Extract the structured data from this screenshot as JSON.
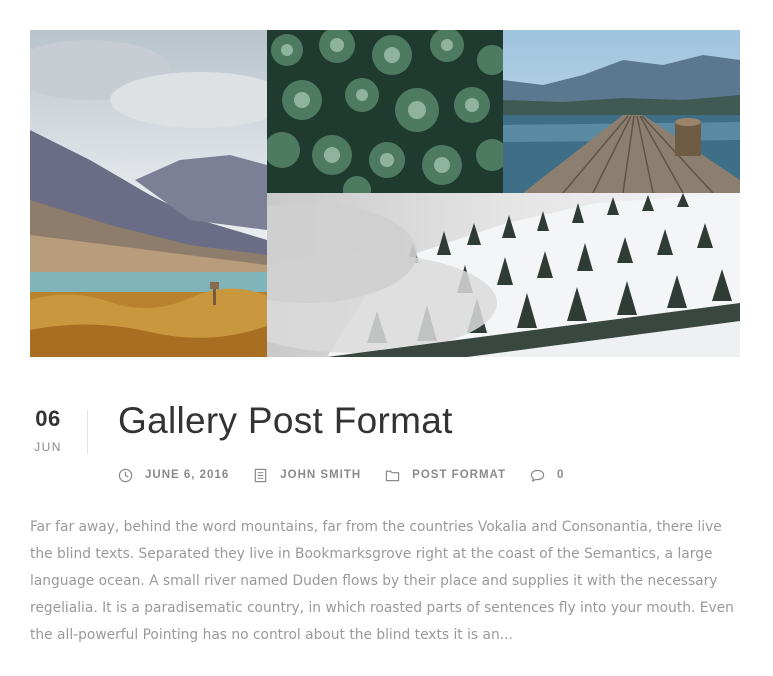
{
  "post": {
    "date_day": "06",
    "date_month": "JUN",
    "title": "Gallery Post Format",
    "meta": {
      "date": "JUNE 6, 2016",
      "author": "JOHN SMITH",
      "category": "POST FORMAT",
      "comments": "0"
    },
    "excerpt": "Far far away, behind the word mountains, far from the countries Vokalia and Consonantia, there live the blind texts. Separated they live in Bookmarksgrove right at the coast of the Semantics, a large language ocean. A small river named Duden flows by their place and supplies it with the necessary regelialia. It is a paradisematic country, in which roasted parts of sentences fly into your mouth. Even the all-powerful Pointing has no control about the blind texts it is an..."
  },
  "gallery": {
    "images": [
      {
        "icon": "mountain-lake-llama-photo"
      },
      {
        "icon": "succulent-plants-photo"
      },
      {
        "icon": "lake-pier-photo"
      },
      {
        "icon": "snowy-forest-mountain-photo"
      }
    ]
  },
  "colors": {
    "title": "#333333",
    "meta": "#8a8a8a",
    "excerpt": "#999999",
    "divider": "#e4e4e4"
  },
  "icons": {
    "date": "clock-icon",
    "author": "document-icon",
    "category": "folder-icon",
    "comments": "comment-bubble-icon"
  }
}
